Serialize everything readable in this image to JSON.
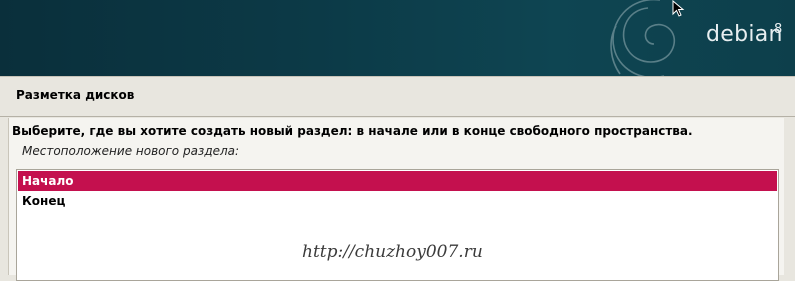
{
  "header": {
    "logo_text": "debian",
    "version": "8",
    "logo_icon": "debian-swirl-icon",
    "cursor_icon": "mouse-pointer-icon"
  },
  "section": {
    "title": "Разметка дисков"
  },
  "dialog": {
    "question": "Выберите, где вы хотите создать новый раздел: в начале или в конце свободного пространства.",
    "prompt": "Местоположение нового раздела:",
    "options": [
      {
        "label": "Начало",
        "selected": true
      },
      {
        "label": "Конец",
        "selected": false
      }
    ]
  },
  "watermark": "http://chuzhoy007.ru",
  "colors": {
    "banner": "#0c3a47",
    "selection": "#c4104e",
    "background": "#e8e6df"
  }
}
